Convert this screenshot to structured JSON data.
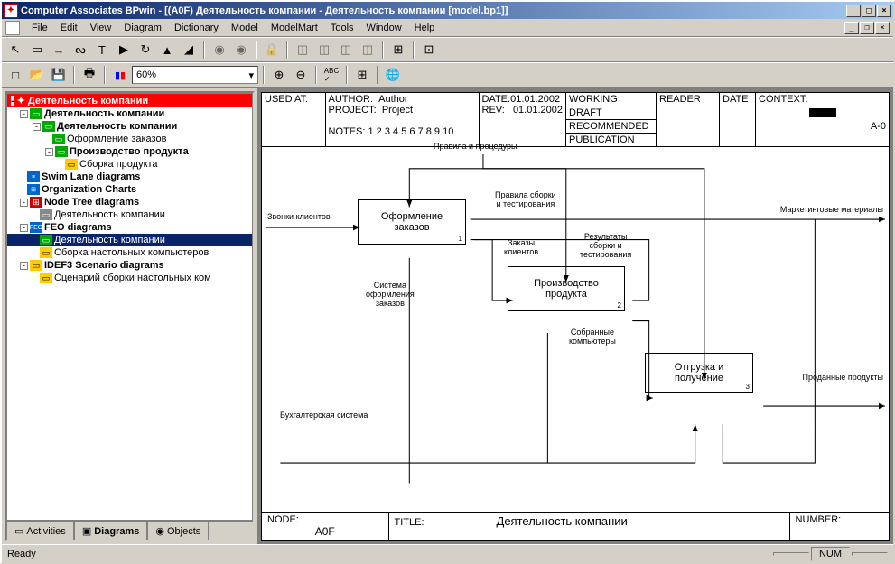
{
  "title": "Computer Associates BPwin - [(A0F) Деятельность компании - Деятельность компании  [model.bp1]]",
  "menu": [
    "File",
    "Edit",
    "View",
    "Diagram",
    "Dictionary",
    "Model",
    "ModelMart",
    "Tools",
    "Window",
    "Help"
  ],
  "zoom": "60%",
  "tree": {
    "root": "Деятельность компании",
    "n1": "Деятельность компании",
    "n2": "Деятельность компании",
    "n3": "Оформление заказов",
    "n4": "Производство продукта",
    "n5": "Сборка продукта",
    "n6": "Swim Lane diagrams",
    "n7": "Organization Charts",
    "n8": "Node Tree diagrams",
    "n9": "Деятельность компании",
    "n10": "FEO diagrams",
    "n11": "Деятельность компании",
    "n12": "Сборка настольных компьютеров",
    "n13": "IDEF3 Scenario diagrams",
    "n14": "Сценарий сборки настольных ком"
  },
  "tabs": {
    "activities": "Activities",
    "diagrams": "Diagrams",
    "objects": "Objects"
  },
  "header": {
    "used_at": "USED AT:",
    "author_lbl": "AUTHOR:",
    "author": "Author",
    "project_lbl": "PROJECT:",
    "project": "Project",
    "date_lbl": "DATE:",
    "date": "01.01.2002",
    "rev_lbl": "REV:",
    "rev": "01.01.2002",
    "working": "WORKING",
    "draft": "DRAFT",
    "recommended": "RECOMMENDED",
    "publication": "PUBLICATION",
    "reader": "READER",
    "date2": "DATE",
    "context": "CONTEXT:",
    "notes": "NOTES:  1  2  3  4  5  6  7  8  9  10",
    "a0": "A-0"
  },
  "diagram": {
    "top_arrow": "Правила и процедуры",
    "box1": "Оформление заказов",
    "box2": "Производство продукта",
    "box3": "Отгрузка и получение",
    "in1": "Звонки клиентов",
    "out1": "Маркетинговые материалы",
    "out2": "Проданные продукты",
    "lbl_rules": "Правила сборки\nи тестирования",
    "lbl_orders": "Заказы\nклиентов",
    "lbl_results": "Результаты\nсборки и\nтестирования",
    "lbl_system": "Система\nоформления\nзаказов",
    "lbl_assembled": "Собранные\nкомпьютеры",
    "lbl_accounting": "Бухгалтерская система"
  },
  "footer": {
    "node_lbl": "NODE:",
    "node": "A0F",
    "title_lbl": "TITLE:",
    "title": "Деятельность компании",
    "number_lbl": "NUMBER:"
  },
  "status": {
    "ready": "Ready",
    "num": "NUM"
  }
}
